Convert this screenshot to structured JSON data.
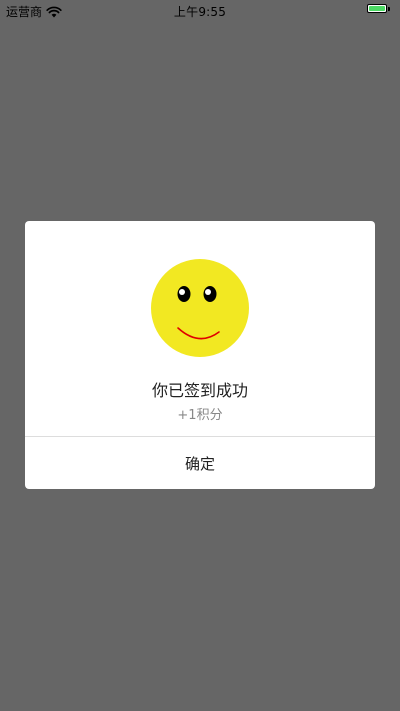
{
  "status_bar": {
    "carrier": "运营商",
    "time": "上午9:55",
    "battery_color": "#4cd964"
  },
  "dialog": {
    "icon": "smiley-face-icon",
    "message": "你已签到成功",
    "points": "+1积分",
    "confirm_label": "确定"
  },
  "colors": {
    "overlay": "#666666",
    "smiley_face": "#f2e822",
    "smile": "#e00000"
  }
}
